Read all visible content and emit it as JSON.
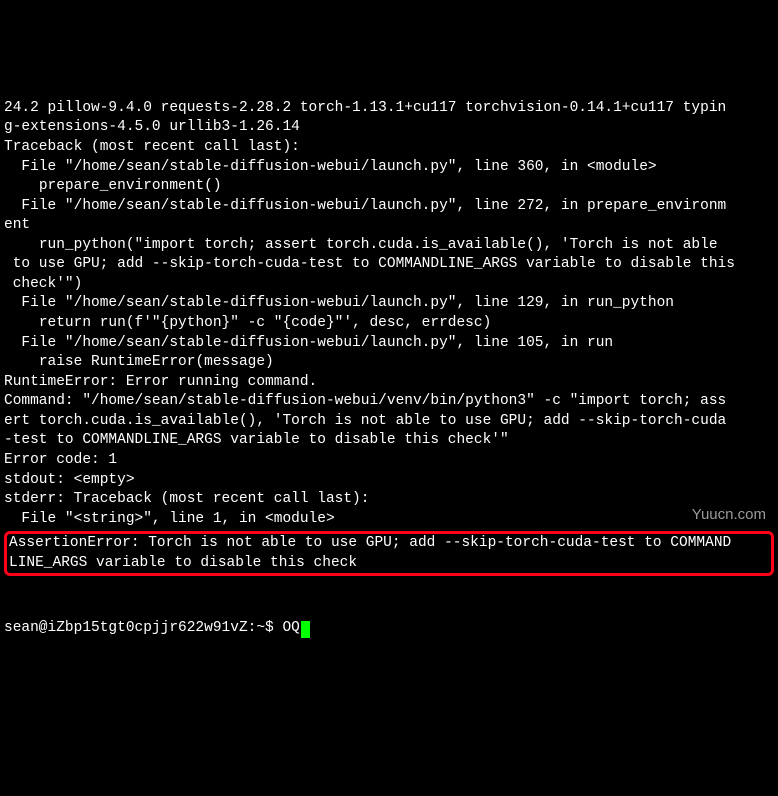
{
  "terminal": {
    "packages_line1": "24.2 pillow-9.4.0 requests-2.28.2 torch-1.13.1+cu117 torchvision-0.14.1+cu117 typin",
    "packages_line2": "g-extensions-4.5.0 urllib3-1.26.14",
    "tb_header": "Traceback (most recent call last):",
    "tb_f1": "  File \"/home/sean/stable-diffusion-webui/launch.py\", line 360, in <module>",
    "tb_c1": "    prepare_environment()",
    "tb_f2a": "  File \"/home/sean/stable-diffusion-webui/launch.py\", line 272, in prepare_environm",
    "tb_f2b": "ent",
    "tb_c2a": "    run_python(\"import torch; assert torch.cuda.is_available(), 'Torch is not able",
    "tb_c2b": " to use GPU; add --skip-torch-cuda-test to COMMANDLINE_ARGS variable to disable this",
    "tb_c2c": " check'\")",
    "tb_f3": "  File \"/home/sean/stable-diffusion-webui/launch.py\", line 129, in run_python",
    "tb_c3": "    return run(f'\"{python}\" -c \"{code}\"', desc, errdesc)",
    "tb_f4": "  File \"/home/sean/stable-diffusion-webui/launch.py\", line 105, in run",
    "tb_c4": "    raise RuntimeError(message)",
    "runtime_err": "RuntimeError: Error running command.",
    "cmd_l1": "Command: \"/home/sean/stable-diffusion-webui/venv/bin/python3\" -c \"import torch; ass",
    "cmd_l2": "ert torch.cuda.is_available(), 'Torch is not able to use GPU; add --skip-torch-cuda",
    "cmd_l3": "-test to COMMANDLINE_ARGS variable to disable this check'\"",
    "err_code": "Error code: 1",
    "stdout_line": "stdout: <empty>",
    "stderr_hdr": "stderr: Traceback (most recent call last):",
    "stderr_f1": "  File \"<string>\", line 1, in <module>",
    "assert_l1": "AssertionError: Torch is not able to use GPU; add --skip-torch-cuda-test to COMMAND",
    "assert_l2": "LINE_ARGS variable to disable this check",
    "blank": "",
    "prompt": "sean@iZbp15tgt0cpjjr622w91vZ:~$ ",
    "typed": "OQ"
  },
  "watermark": "Yuucn.com"
}
